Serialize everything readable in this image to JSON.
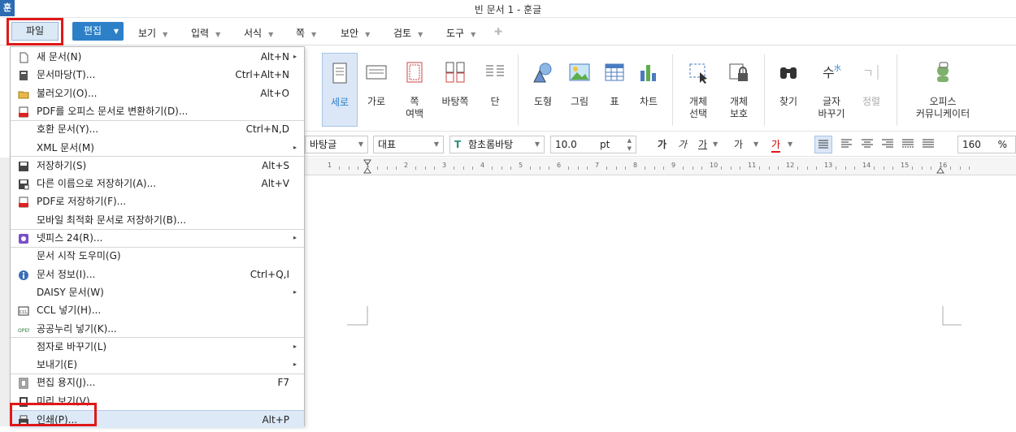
{
  "window": {
    "app_icon": "훈",
    "title": "빈 문서 1 - 훈글"
  },
  "menubar": {
    "file": "파일",
    "edit": "편집",
    "items": [
      "보기",
      "입력",
      "서식",
      "쪽",
      "보안",
      "검토",
      "도구"
    ]
  },
  "ribbon": {
    "portrait": "세로",
    "landscape": "가로",
    "margin_1": "쪽",
    "margin_2": "여백",
    "master": "바탕쪽",
    "column": "단",
    "shape": "도형",
    "picture": "그림",
    "table": "표",
    "chart": "차트",
    "obj_select_1": "개체",
    "obj_select_2": "선택",
    "obj_protect_1": "개체",
    "obj_protect_2": "보호",
    "find": "찾기",
    "replace_1": "글자",
    "replace_2": "바꾸기",
    "sort": "정렬",
    "office_1": "오피스",
    "office_2": "커뮤니케이터"
  },
  "format": {
    "style": "바탕글",
    "lang": "대표",
    "font": "함초롬바탕",
    "size": "10.0",
    "unit": "pt",
    "bold": "가",
    "italic": "가",
    "underline": "가",
    "strike": "가",
    "color": "가",
    "zoom": "160",
    "zoom_unit": "%"
  },
  "ruler_numbers": [
    "1",
    "1",
    "2",
    "3",
    "4",
    "5",
    "6",
    "7",
    "8",
    "9",
    "10",
    "11",
    "12",
    "13",
    "14",
    "15",
    "16"
  ],
  "file_menu": [
    {
      "label": "새 문서(N)",
      "shortcut": "Alt+N",
      "arrow": true,
      "icon": "new-document-icon"
    },
    {
      "label": "문서마당(T)...",
      "shortcut": "Ctrl+Alt+N",
      "icon": "template-icon"
    },
    {
      "label": "불러오기(O)...",
      "shortcut": "Alt+O",
      "icon": "open-folder-icon"
    },
    {
      "label": "PDF를 오피스 문서로 변환하기(D)...",
      "shortcut": "",
      "icon": "pdf-convert-icon"
    },
    {
      "label": "호환 문서(Y)...",
      "shortcut": "Ctrl+N,D",
      "sep_before": true
    },
    {
      "label": "XML 문서(M)",
      "shortcut": "",
      "arrow": true
    },
    {
      "label": "저장하기(S)",
      "shortcut": "Alt+S",
      "sep_before": true,
      "icon": "save-icon"
    },
    {
      "label": "다른 이름으로 저장하기(A)...",
      "shortcut": "Alt+V",
      "icon": "save-as-icon"
    },
    {
      "label": "PDF로 저장하기(F)...",
      "shortcut": "",
      "icon": "pdf-save-icon"
    },
    {
      "label": "모바일 최적화 문서로 저장하기(B)...",
      "shortcut": ""
    },
    {
      "label": "넷피스 24(R)...",
      "shortcut": "",
      "arrow": true,
      "sep_before": true,
      "icon": "netffice-icon"
    },
    {
      "label": "문서 시작 도우미(G)",
      "shortcut": "",
      "sep_before": true
    },
    {
      "label": "문서 정보(I)...",
      "shortcut": "Ctrl+Q,I",
      "icon": "info-icon"
    },
    {
      "label": "DAISY 문서(W)",
      "shortcut": "",
      "arrow": true
    },
    {
      "label": "CCL 넣기(H)...",
      "shortcut": "",
      "icon": "ccl-icon"
    },
    {
      "label": "공공누리 넣기(K)...",
      "shortcut": "",
      "icon": "kogl-icon"
    },
    {
      "label": "점자로 바꾸기(L)",
      "shortcut": "",
      "arrow": true,
      "sep_before": true
    },
    {
      "label": "보내기(E)",
      "shortcut": "",
      "arrow": true
    },
    {
      "label": "편집 용지(J)...",
      "shortcut": "F7",
      "sep_before": true,
      "icon": "page-setup-icon"
    },
    {
      "label": "미리 보기(V)",
      "shortcut": "",
      "icon": "preview-icon"
    },
    {
      "label": "인쇄(P)...",
      "shortcut": "Alt+P",
      "sep_before": true,
      "icon": "print-icon",
      "hover": true
    }
  ],
  "colors": {
    "accent": "#2d80c8",
    "highlight_box": "#e01818",
    "hover": "#dde9f7"
  }
}
